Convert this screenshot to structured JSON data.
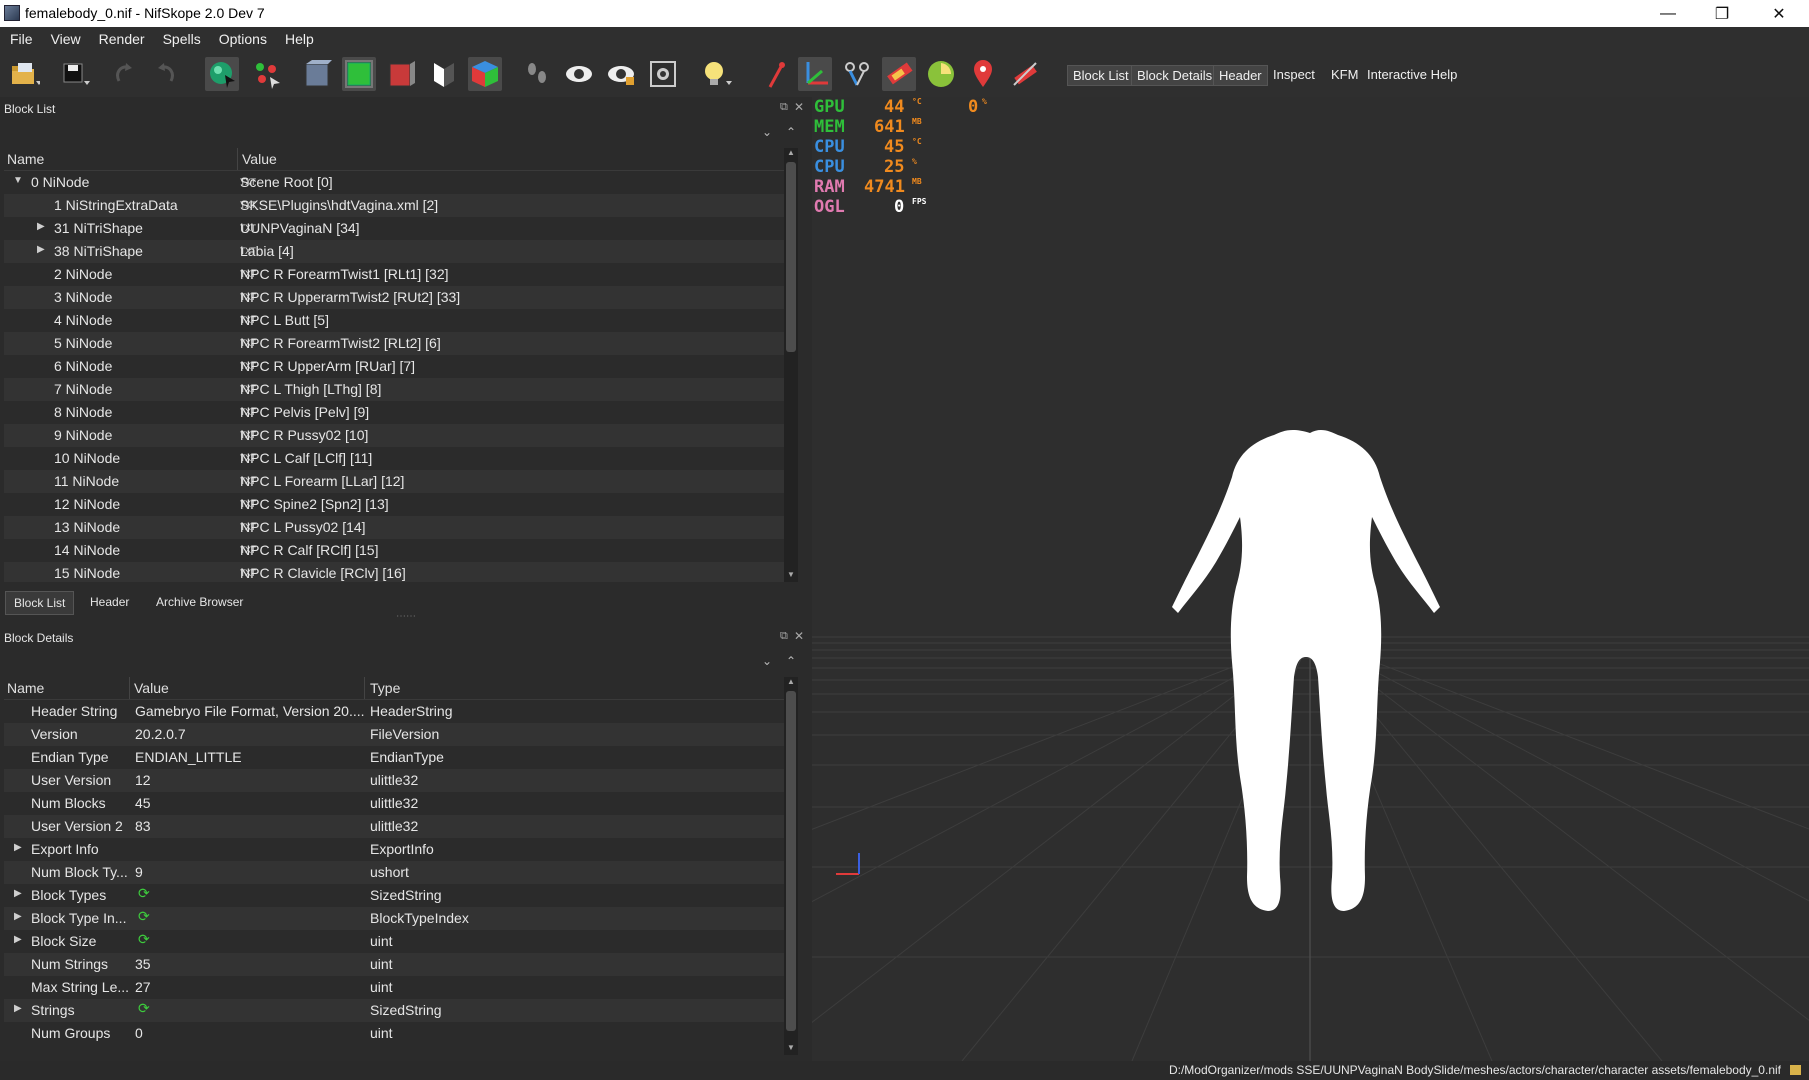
{
  "window": {
    "title": "femalebody_0.nif - NifSkope 2.0 Dev 7",
    "minimize": "—",
    "maximize": "❐",
    "close": "✕"
  },
  "menu": [
    "File",
    "View",
    "Render",
    "Spells",
    "Options",
    "Help"
  ],
  "toolbar_text_buttons": [
    "Block List",
    "Block Details",
    "Header",
    "Inspect",
    "KFM",
    "Interactive Help"
  ],
  "block_list": {
    "title": "Block List",
    "columns": [
      "Name",
      "Value"
    ],
    "rows": [
      {
        "name": "0 NiNode",
        "value": "Scene Root [0]"
      },
      {
        "name": "1 NiStringExtraData",
        "value": "SKSE\\Plugins\\hdtVagina.xml [2]"
      },
      {
        "name": "31 NiTriShape",
        "value": "UUNPVaginaN [34]"
      },
      {
        "name": "38 NiTriShape",
        "value": "Labia [4]"
      },
      {
        "name": "2 NiNode",
        "value": "NPC R ForearmTwist1 [RLt1] [32]"
      },
      {
        "name": "3 NiNode",
        "value": "NPC R UpperarmTwist2 [RUt2] [33]"
      },
      {
        "name": "4 NiNode",
        "value": "NPC L Butt [5]"
      },
      {
        "name": "5 NiNode",
        "value": "NPC R ForearmTwist2 [RLt2] [6]"
      },
      {
        "name": "6 NiNode",
        "value": "NPC R UpperArm [RUar] [7]"
      },
      {
        "name": "7 NiNode",
        "value": "NPC L Thigh [LThg] [8]"
      },
      {
        "name": "8 NiNode",
        "value": "NPC Pelvis [Pelv] [9]"
      },
      {
        "name": "9 NiNode",
        "value": "NPC R Pussy02 [10]"
      },
      {
        "name": "10 NiNode",
        "value": "NPC L Calf [LClf] [11]"
      },
      {
        "name": "11 NiNode",
        "value": "NPC L Forearm [LLar] [12]"
      },
      {
        "name": "12 NiNode",
        "value": "NPC Spine2 [Spn2] [13]"
      },
      {
        "name": "13 NiNode",
        "value": "NPC L Pussy02 [14]"
      },
      {
        "name": "14 NiNode",
        "value": "NPC R Calf [RClf] [15]"
      },
      {
        "name": "15 NiNode",
        "value": "NPC R Clavicle [RClv] [16]"
      }
    ],
    "tabs": [
      "Block List",
      "Header",
      "Archive Browser"
    ]
  },
  "block_details": {
    "title": "Block Details",
    "columns": [
      "Name",
      "Value",
      "Type"
    ],
    "rows": [
      {
        "name": "Header String",
        "value": "Gamebryo File Format, Version 20....",
        "type": "HeaderString"
      },
      {
        "name": "Version",
        "value": "20.2.0.7",
        "type": "FileVersion"
      },
      {
        "name": "Endian Type",
        "value": "ENDIAN_LITTLE",
        "type": "EndianType"
      },
      {
        "name": "User Version",
        "value": "12",
        "type": "ulittle32"
      },
      {
        "name": "Num Blocks",
        "value": "45",
        "type": "ulittle32"
      },
      {
        "name": "User Version 2",
        "value": "83",
        "type": "ulittle32"
      },
      {
        "name": "Export Info",
        "value": "",
        "type": "ExportInfo"
      },
      {
        "name": "Num Block Ty...",
        "value": "9",
        "type": "ushort"
      },
      {
        "name": "Block Types",
        "value": "",
        "type": "SizedString"
      },
      {
        "name": "Block Type In...",
        "value": "",
        "type": "BlockTypeIndex"
      },
      {
        "name": "Block Size",
        "value": "",
        "type": "uint"
      },
      {
        "name": "Num Strings",
        "value": "35",
        "type": "uint"
      },
      {
        "name": "Max String Le...",
        "value": "27",
        "type": "uint"
      },
      {
        "name": "Strings",
        "value": "",
        "type": "SizedString"
      },
      {
        "name": "Num Groups",
        "value": "0",
        "type": "uint"
      }
    ]
  },
  "stats": [
    {
      "label": "GPU",
      "value": "44",
      "unit": "°C",
      "label_color": "#2fbf3a",
      "value_color": "#f08a1e"
    },
    {
      "label": "MEM",
      "value": "641",
      "unit": "MB",
      "label_color": "#2fbf3a",
      "value_color": "#f08a1e"
    },
    {
      "label": "CPU",
      "value": "45",
      "unit": "°C",
      "label_color": "#3a8fe0",
      "value_color": "#f08a1e"
    },
    {
      "label": "CPU",
      "value": "25",
      "unit": "%",
      "label_color": "#3a8fe0",
      "value_color": "#f08a1e"
    },
    {
      "label": "RAM",
      "value": "4741",
      "unit": "MB",
      "label_color": "#e07ab0",
      "value_color": "#f08a1e"
    },
    {
      "label": "OGL",
      "value": "0",
      "unit": "FPS",
      "label_color": "#e07ab0",
      "value_color": "#ffffff"
    }
  ],
  "gpu_usage": {
    "value": "0",
    "unit": "%"
  },
  "status_path": "D:/ModOrganizer/mods SSE/UUNPVaginaN BodySlide/meshes/actors/character/character assets/femalebody_0.nif"
}
